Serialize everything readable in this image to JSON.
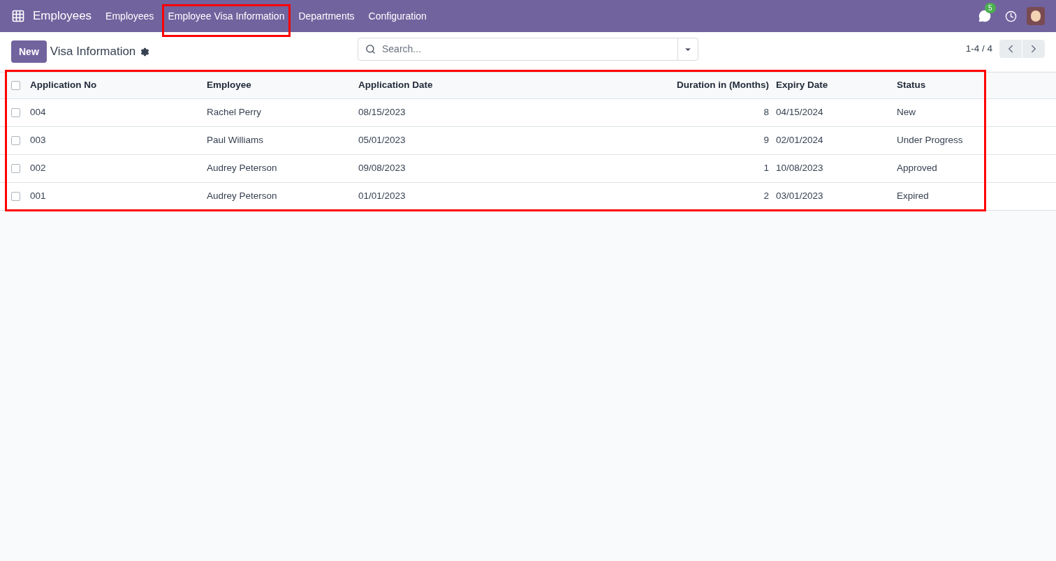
{
  "navbar": {
    "app_name": "Employees",
    "menu": [
      "Employees",
      "Employee Visa Information",
      "Departments",
      "Configuration"
    ],
    "messages_badge": "5"
  },
  "control_panel": {
    "new_button": "New",
    "title": "Visa Information",
    "search": {
      "placeholder": "Search..."
    },
    "pager": "1-4 / 4"
  },
  "table": {
    "columns": [
      "Application No",
      "Employee",
      "Application Date",
      "Duration in (Months)",
      "Expiry Date",
      "Status"
    ],
    "all_checked": false,
    "rows": [
      {
        "checked": false,
        "cells": [
          "004",
          "Rachel Perry",
          "08/15/2023",
          "8",
          "04/15/2024",
          "New"
        ]
      },
      {
        "checked": false,
        "cells": [
          "003",
          "Paul Williams",
          "05/01/2023",
          "9",
          "02/01/2024",
          "Under Progress"
        ]
      },
      {
        "checked": false,
        "cells": [
          "002",
          "Audrey Peterson",
          "09/08/2023",
          "1",
          "10/08/2023",
          "Approved"
        ]
      },
      {
        "checked": false,
        "cells": [
          "001",
          "Audrey Peterson",
          "01/01/2023",
          "2",
          "03/01/2023",
          "Expired"
        ]
      }
    ]
  }
}
